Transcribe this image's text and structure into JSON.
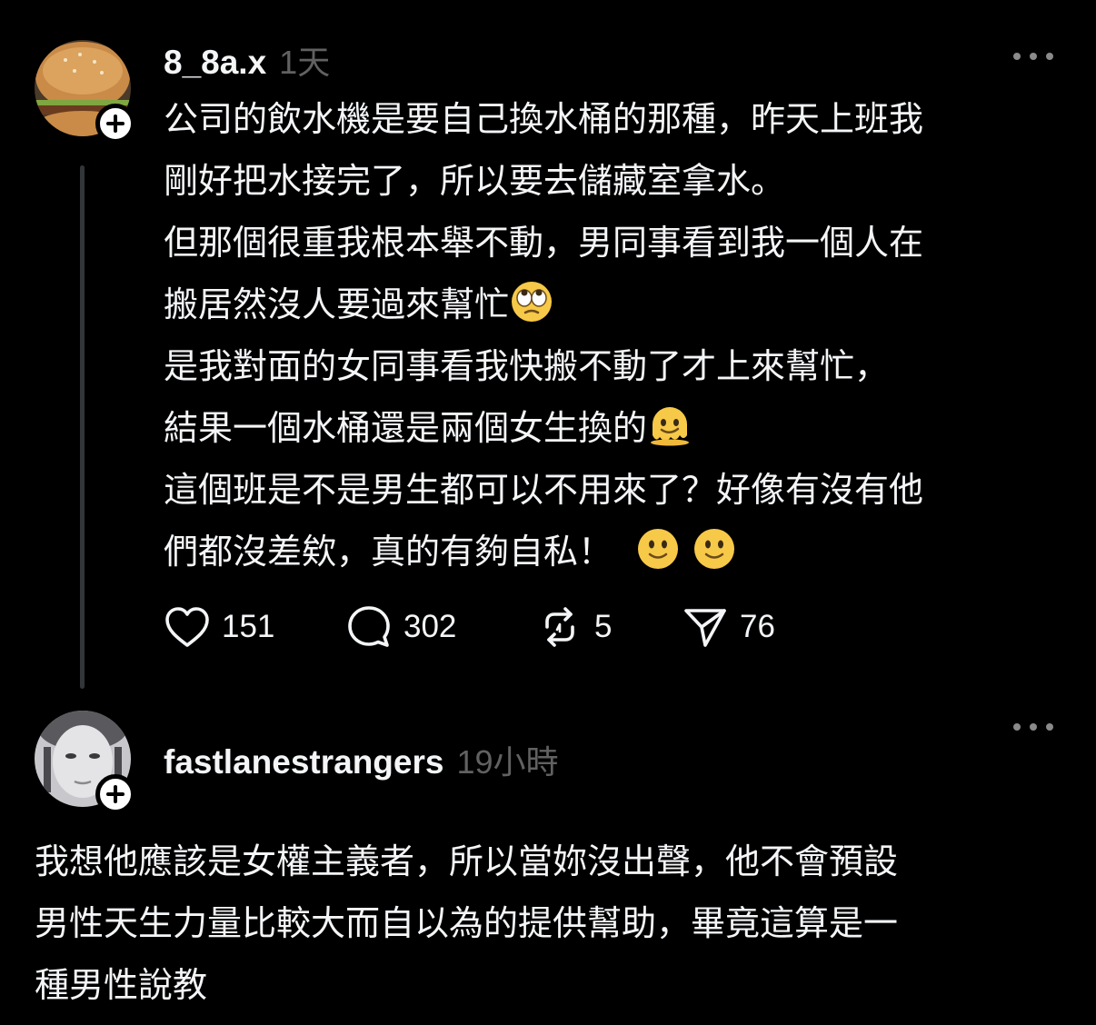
{
  "posts": [
    {
      "username": "8_8a.x",
      "time": "1天",
      "lines": [
        "公司的飲水機是要自己換水桶的那種，昨天上班我",
        "剛好把水接完了，所以要去儲藏室拿水。",
        "但那個很重我根本舉不動，男同事看到我一個人在",
        "搬居然沒人要過來幫忙",
        "是我對面的女同事看我快搬不動了才上來幫忙，",
        "結果一個水桶還是兩個女生換的",
        "這個班是不是男生都可以不用來了？好像有沒有他",
        "們都沒差欸，真的有夠自私！ "
      ],
      "emojis": [
        "eye-roll-emoji",
        "melting-face-emoji",
        "slightly-smiling-face-emoji",
        "slightly-smiling-face-emoji"
      ],
      "likes": "151",
      "comments": "302",
      "reposts": "5",
      "shares": "76"
    },
    {
      "username": "fastlanestrangers",
      "time": "19小時",
      "lines": [
        "我想他應該是女權主義者，所以當妳沒出聲，他不會預設",
        "男性天生力量比較大而自以為的提供幫助，畢竟這算是一",
        "種男性說教"
      ]
    }
  ],
  "icons": {
    "more": "more-horizontal-icon",
    "like": "heart-icon",
    "comment": "comment-bubble-icon",
    "repost": "repost-icon",
    "share": "send-icon",
    "follow": "plus-icon"
  },
  "colors": {
    "background": "#000000",
    "text": "#f3f5f7",
    "secondary_text": "#616161",
    "thread_line": "#333638",
    "follow_badge": "#ffffff"
  }
}
